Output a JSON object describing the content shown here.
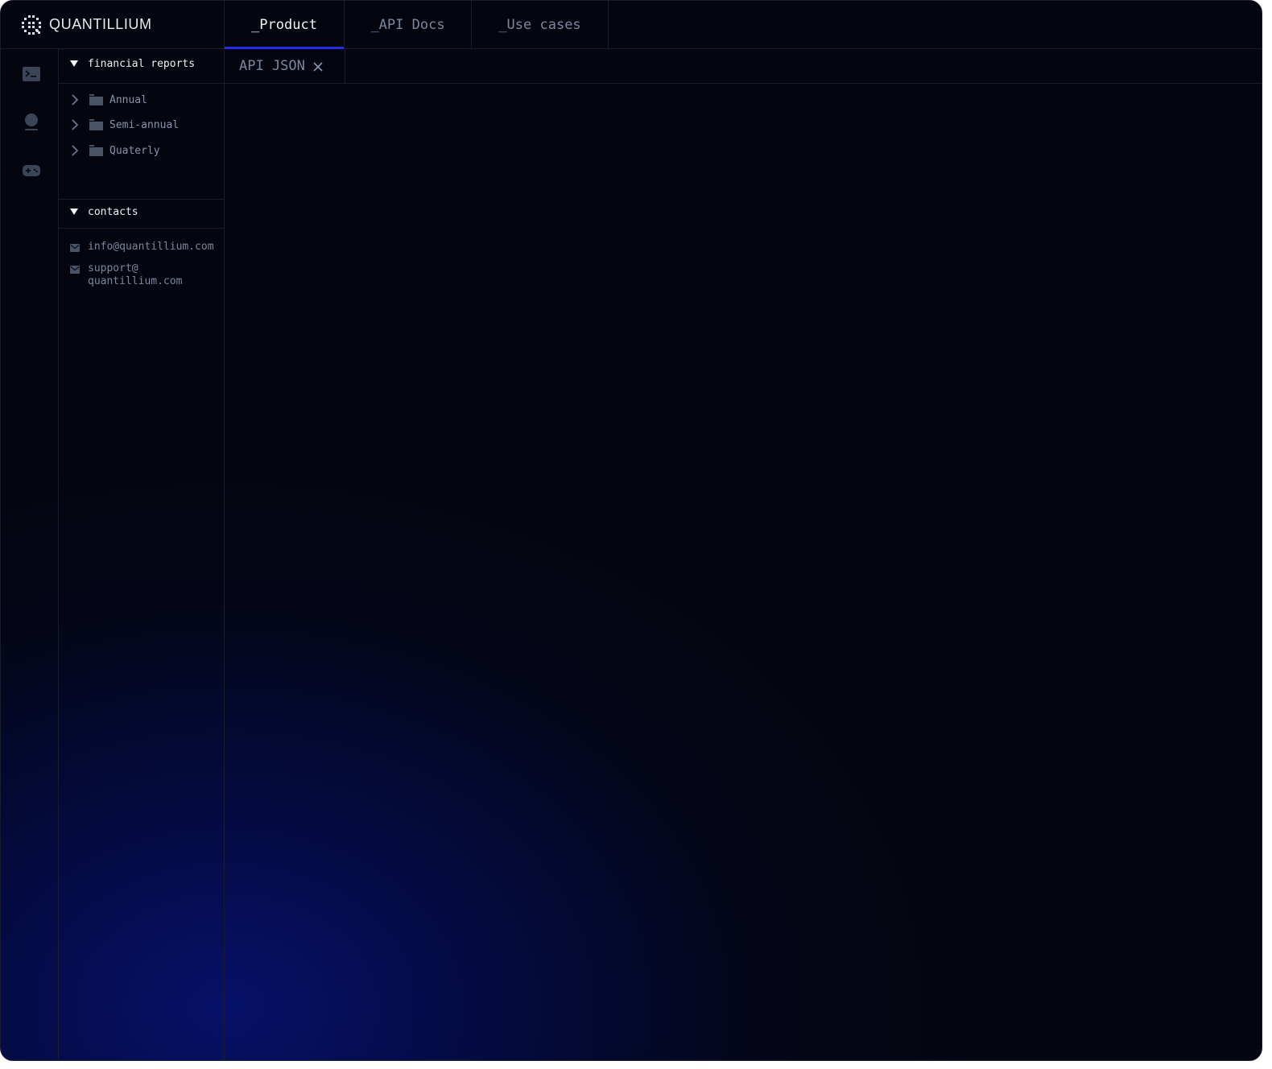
{
  "brand": {
    "name": "QUANTILLIUM",
    "logo_icon": "quantillium-logo"
  },
  "nav": {
    "tabs": [
      {
        "label": "_Product",
        "active": true
      },
      {
        "label": "_API Docs",
        "active": false
      },
      {
        "label": "_Use cases",
        "active": false
      }
    ],
    "active_underline_color": "#1e2ee6"
  },
  "activity_bar": {
    "icons": [
      "terminal-icon",
      "user-icon",
      "gamepad-icon"
    ]
  },
  "sidebar": {
    "financial": {
      "title": "financial reports",
      "expanded": true,
      "folders": [
        {
          "label": "Annual",
          "icon": "folder-icon"
        },
        {
          "label": "Semi-annual",
          "icon": "folder-icon"
        },
        {
          "label": "Quaterly",
          "icon": "folder-icon"
        }
      ]
    },
    "contacts": {
      "title": "contacts",
      "expanded": true,
      "items": [
        {
          "label": "info@quantillium.com",
          "icon": "mail-icon"
        },
        {
          "label": "support@\nquantillium.com",
          "icon": "mail-icon"
        }
      ]
    }
  },
  "editor": {
    "tabs": [
      {
        "label": "API JSON",
        "closable": true
      }
    ]
  },
  "colors": {
    "background": "#04050e",
    "border": "#1a1d2c",
    "glow": "#06126e",
    "muted_text": "#7d879c",
    "bright_text": "#eef0f5"
  }
}
